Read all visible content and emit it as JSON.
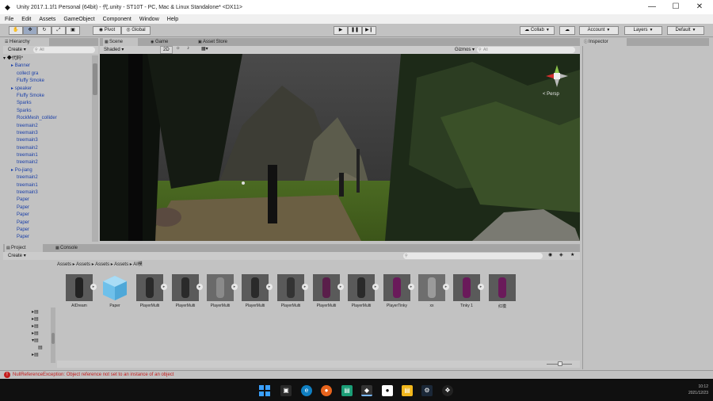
{
  "window": {
    "title": "Unity 2017.1.1f1 Personal (64bit) - 代.unity - ST10T - PC, Mac & Linux Standalone* <DX11>",
    "controls": [
      "—",
      "☐",
      "✕"
    ]
  },
  "menu": [
    "File",
    "Edit",
    "Assets",
    "GameObject",
    "Component",
    "Window",
    "Help"
  ],
  "toolbar": {
    "pivot": "Pivot",
    "global": "Global",
    "collab": "Collab",
    "account": "Account",
    "layers": "Layers",
    "layout": "Default"
  },
  "hierarchy": {
    "tab": "Hierarchy",
    "create": "Create",
    "search_placeholder": "All",
    "items": [
      "代码*",
      "Banner",
      "collect gra",
      "Fluffy Smoke",
      "speaker",
      "Fluffy Smoke",
      "Sparks",
      "Sparks",
      "RockMesh_collider",
      "treemain2",
      "treemain3",
      "treemain3",
      "treemain2",
      "treemain1",
      "treemain2",
      "Po-jiang",
      "treemain2",
      "treemain1",
      "treemain3",
      "Paper",
      "Paper",
      "Paper",
      "Paper",
      "Paper",
      "Paper"
    ]
  },
  "scene": {
    "tabs": [
      "Scene",
      "Game",
      "Asset Store"
    ],
    "shaded": "Shaded",
    "twod": "2D",
    "gizmos": "Gizmos",
    "search_placeholder": "All",
    "persp_label": "< Persp"
  },
  "inspector": {
    "tab": "Inspector"
  },
  "project": {
    "tabs": [
      "Project",
      "Console"
    ],
    "create": "Create",
    "breadcrumb": [
      "Assets",
      "Assets",
      "Assets",
      "Assets",
      "AI模"
    ],
    "assets": [
      "AIDream",
      "Paper",
      "PlayerMulti",
      "PlayerMulti",
      "PlayerMulti",
      "PlayerMulti",
      "PlayerMulti",
      "PlayerMulti",
      "PlayerMulti",
      "PlayerTinky",
      "xx",
      "Tinky 1",
      "红模"
    ]
  },
  "status": {
    "message": "NullReferenceException: Object reference not set to an instance of an object"
  },
  "taskbar": {
    "time": "10:12",
    "date": "2021/12/23"
  },
  "colors": {
    "editor_bg": "#c2c2c2",
    "tab_bg": "#a5a5a5",
    "link_blue": "#1a3fa8",
    "error_red": "#c41c1c",
    "taskbar_bg": "#101010"
  }
}
